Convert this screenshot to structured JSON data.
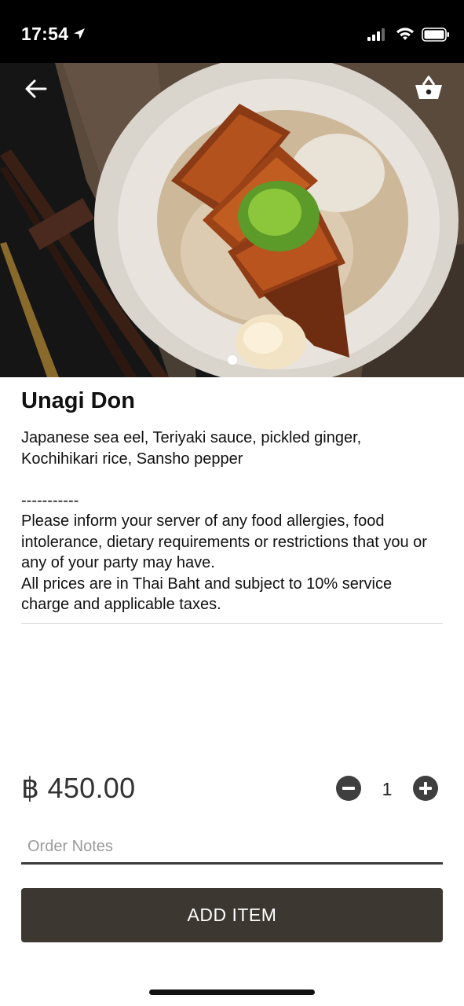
{
  "status_bar": {
    "time": "17:54",
    "icons": [
      "location-arrow-icon",
      "cellular-signal-icon",
      "wifi-icon",
      "battery-icon"
    ]
  },
  "header": {
    "back_icon": "arrow-left-icon",
    "basket_icon": "basket-icon",
    "image_alt_subject": "Unagi Don",
    "carousel_active_page": 1,
    "carousel_page_count": 1
  },
  "item": {
    "name": "Unagi Don",
    "description": "Japanese sea eel, Teriyaki sauce, pickled ginger,\nKochihikari rice, Sansho pepper\n\n-----------\nPlease inform your server of any food allergies, food intolerance, dietary requirements or restrictions that you or any of your party may have.\nAll prices are in Thai Baht and subject to 10% service charge and applicable taxes.",
    "price": "฿ 450.00"
  },
  "quantity": {
    "value": "1",
    "minus_icon": "minus-circle-icon",
    "plus_icon": "plus-circle-icon"
  },
  "order_notes": {
    "value": "",
    "placeholder": "Order Notes"
  },
  "actions": {
    "add_label": "ADD ITEM"
  },
  "colors": {
    "primary_button": "#3d3731",
    "status_bar": "#000000",
    "qty_button": "#3f3f3f"
  }
}
